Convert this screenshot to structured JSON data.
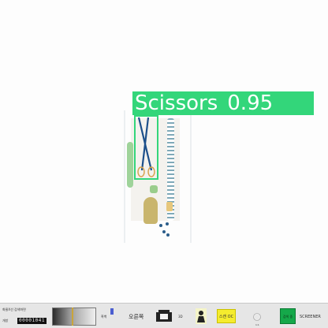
{
  "detection": {
    "label": "Scissors",
    "confidence": "0.95",
    "color": "#33d67a"
  },
  "toolbar": {
    "title": "화물X선 검색화면",
    "counter_prefix": "개방",
    "counter": "00001041",
    "gray_label": "흑백",
    "direction_label": "오른쪽",
    "mode_label": "3D",
    "scan_button": "스캔 OC",
    "screener_status": "검색 중",
    "screener_label": "SCREENER",
    "tiny_code": "1:1"
  },
  "icons": {
    "gray_icon": "gradient-bar-icon",
    "scanner_icon": "scanner-machine-icon",
    "person_icon": "operator-icon",
    "radiation_icon": "radiation-warning-icon"
  },
  "colors": {
    "scan_button": "#f5ec2e",
    "screener_status": "#15a84a"
  }
}
